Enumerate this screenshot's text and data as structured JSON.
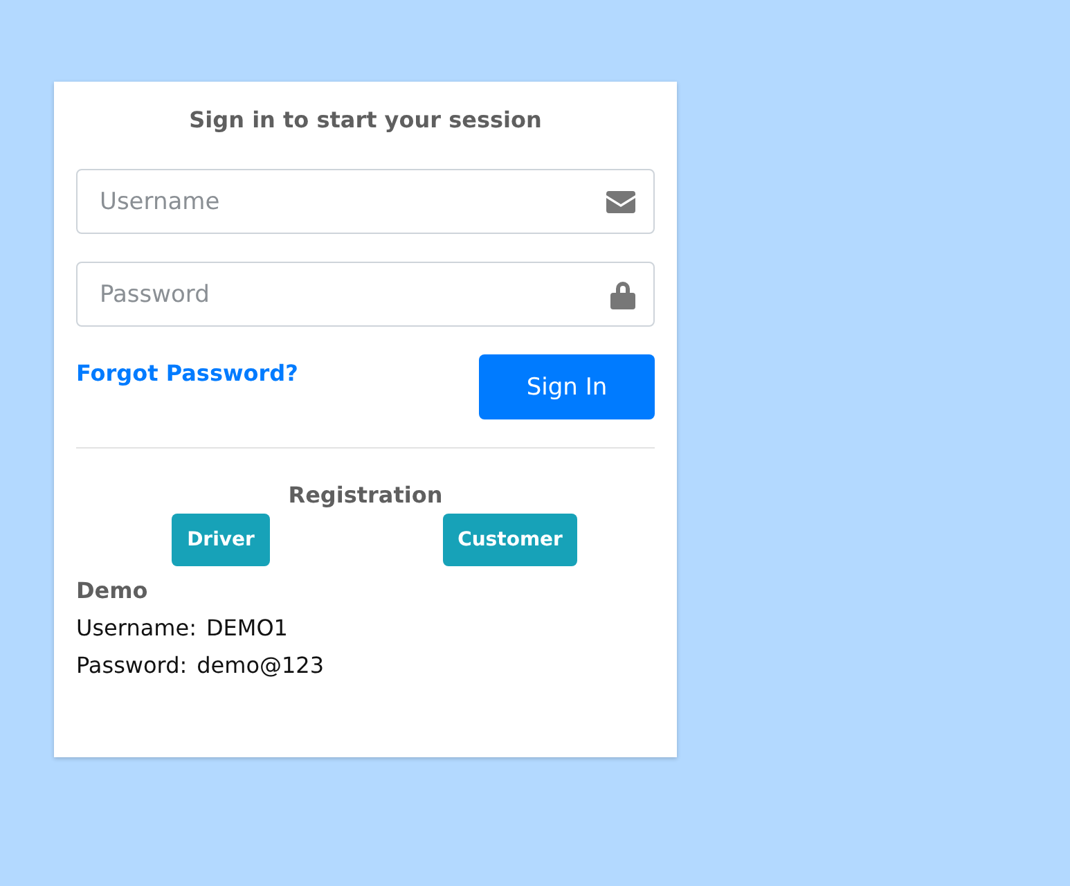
{
  "title": "Sign in to start your session",
  "fields": [
    {
      "placeholder": "Username",
      "kind": "mail"
    },
    {
      "placeholder": "Password",
      "kind": "lock"
    }
  ],
  "forgot_link": "Forgot Password?",
  "sign_in_button": "Sign In",
  "registration": {
    "heading": "Registration",
    "buttons": [
      "Driver",
      "Customer"
    ]
  },
  "demo": {
    "heading": "Demo",
    "lines": [
      {
        "label": "Username:",
        "value": "DEMO1"
      },
      {
        "label": "Password:",
        "value": "demo@123"
      }
    ]
  }
}
